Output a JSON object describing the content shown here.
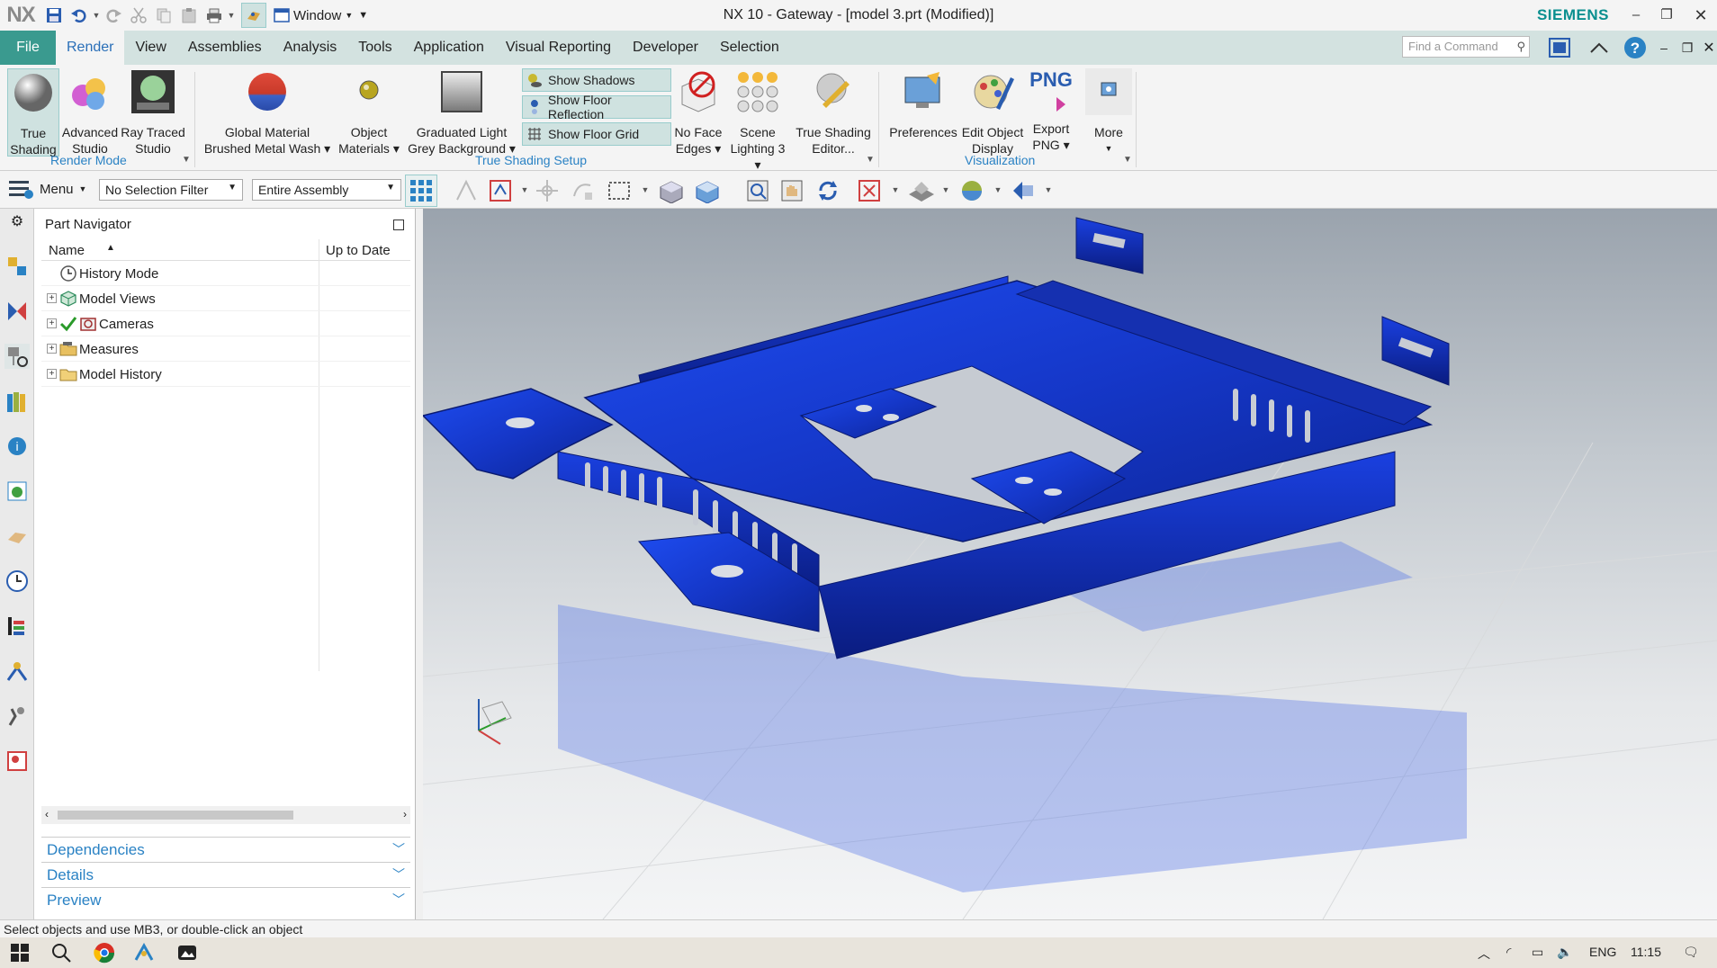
{
  "titlebar": {
    "logo": "NX",
    "window_menu": "Window",
    "title": "NX 10 - Gateway - [model 3.prt (Modified)]",
    "brand": "SIEMENS"
  },
  "menu": {
    "file": "File",
    "tabs": [
      "Render",
      "View",
      "Assemblies",
      "Analysis",
      "Tools",
      "Application",
      "Visual Reporting",
      "Developer",
      "Selection"
    ],
    "find_placeholder": "Find a Command"
  },
  "ribbon": {
    "render_mode": {
      "label": "Render Mode",
      "true_shading": [
        "True",
        "Shading"
      ],
      "advanced_studio": [
        "Advanced",
        "Studio"
      ],
      "ray_traced_studio": [
        "Ray Traced",
        "Studio"
      ]
    },
    "true_shading_setup": {
      "label": "True Shading Setup",
      "global_material": [
        "Global Material",
        "Brushed Metal Wash"
      ],
      "object_materials": [
        "Object",
        "Materials"
      ],
      "graduated_light": [
        "Graduated Light",
        "Grey Background"
      ],
      "show_shadows": "Show Shadows",
      "show_floor_reflection": "Show Floor Reflection",
      "show_floor_grid": "Show Floor Grid",
      "no_face_edges": [
        "No Face",
        "Edges"
      ],
      "scene_lighting": [
        "Scene",
        "Lighting 3"
      ],
      "true_shading_editor": [
        "True Shading",
        "Editor..."
      ]
    },
    "visualization": {
      "label": "Visualization",
      "preferences": "Preferences",
      "edit_object_display": [
        "Edit Object",
        "Display"
      ],
      "export_png": [
        "Export",
        "PNG"
      ],
      "png_text": "PNG",
      "more": "More"
    }
  },
  "selection_bar": {
    "menu": "Menu",
    "filter": "No Selection Filter",
    "scope": "Entire Assembly"
  },
  "navigator": {
    "title": "Part Navigator",
    "col_name": "Name",
    "col_uptodate": "Up to Date",
    "rows": [
      "History Mode",
      "Model Views",
      "Cameras",
      "Measures",
      "Model History"
    ],
    "panels": [
      "Dependencies",
      "Details",
      "Preview"
    ]
  },
  "status": {
    "message": "Select objects and use MB3, or double-click an object"
  },
  "taskbar": {
    "language": "ENG",
    "time": "11:15"
  },
  "colors": {
    "accent": "#3a9a8f",
    "part_blue": "#1a3fd6",
    "label_blue": "#2a82c4"
  }
}
